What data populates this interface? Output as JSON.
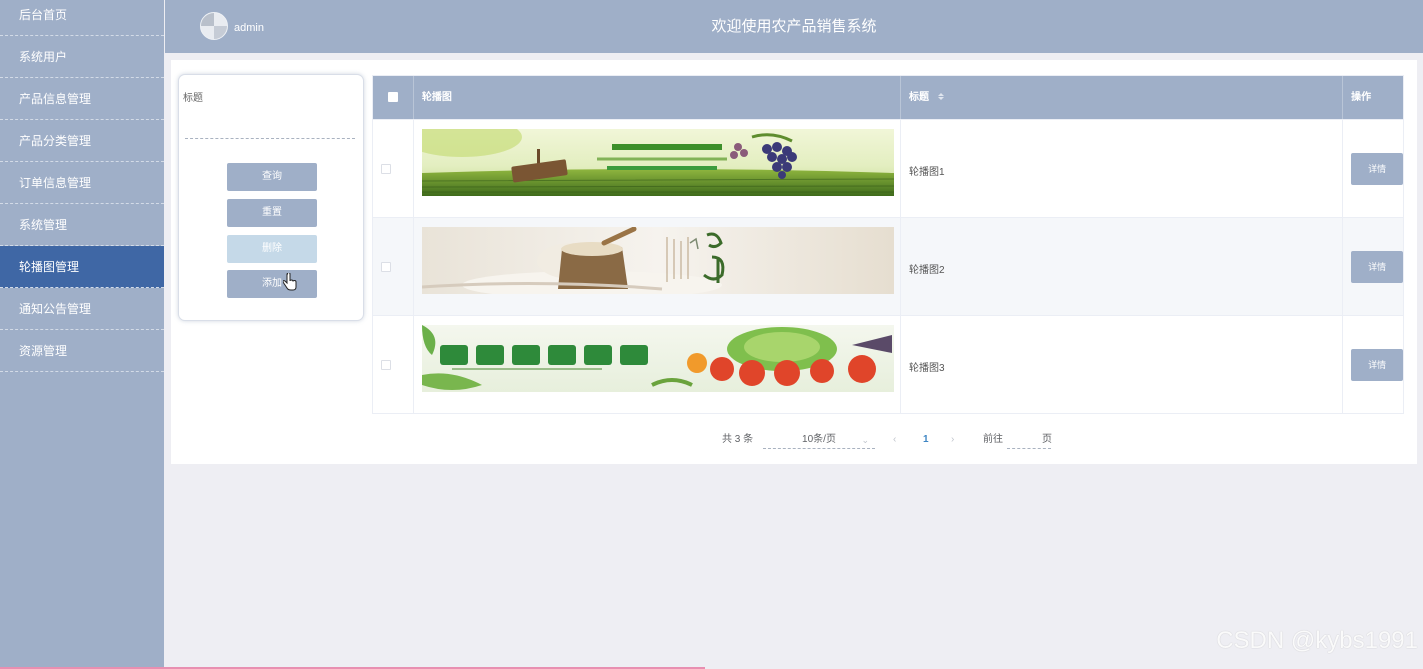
{
  "sidebar": {
    "items": [
      {
        "label": "后台首页"
      },
      {
        "label": "系统用户"
      },
      {
        "label": "产品信息管理"
      },
      {
        "label": "产品分类管理"
      },
      {
        "label": "订单信息管理"
      },
      {
        "label": "系统管理"
      },
      {
        "label": "轮播图管理",
        "active": true
      },
      {
        "label": "通知公告管理"
      },
      {
        "label": "资源管理"
      }
    ]
  },
  "header": {
    "username": "admin",
    "title": "欢迎使用农产品销售系统"
  },
  "search": {
    "label": "标题",
    "value": "",
    "query_label": "查询",
    "reset_label": "重置",
    "delete_label": "删除",
    "add_label": "添加"
  },
  "table": {
    "columns": [
      "轮播图",
      "标题",
      "操作"
    ],
    "rows": [
      {
        "title": "轮播图1",
        "action": "详情",
        "image": "banner-grapes-field"
      },
      {
        "title": "轮播图2",
        "action": "详情",
        "image": "banner-rice-sack"
      },
      {
        "title": "轮播图3",
        "action": "详情",
        "image": "banner-vegetables"
      }
    ]
  },
  "pagination": {
    "total": "共 3 条",
    "page_size": "10条/页",
    "current_page": "1",
    "goto_label": "前往",
    "page_label": "页"
  },
  "watermark": "CSDN @kybs1991",
  "colors": {
    "sidebar": "#9fafc8",
    "active": "#3f67a5",
    "header": "#9fafc8",
    "button": "#9fafc8",
    "button_disabled": "#c5d9e8"
  }
}
